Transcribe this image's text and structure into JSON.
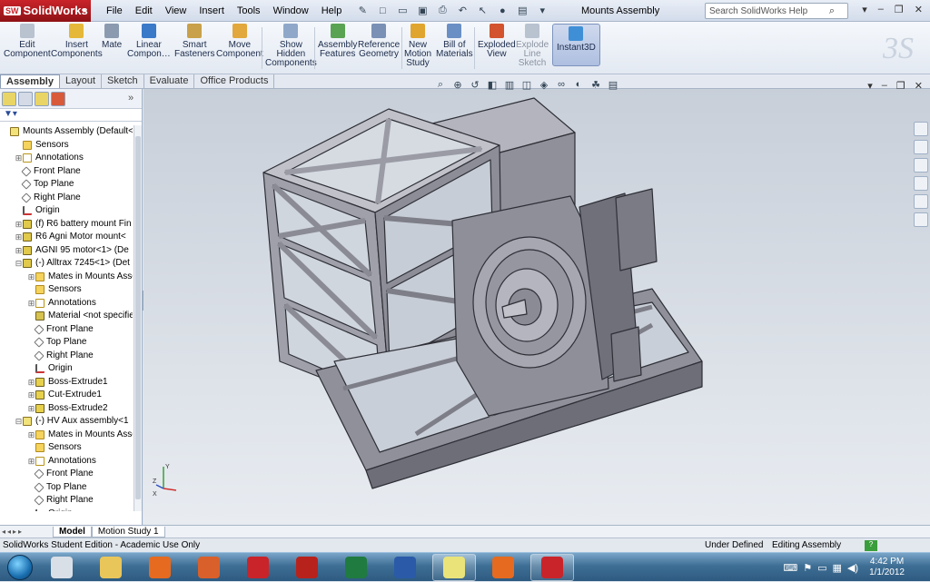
{
  "titlebar": {
    "logo_text": "SolidWorks",
    "menu": [
      "File",
      "Edit",
      "View",
      "Insert",
      "Tools",
      "Window",
      "Help"
    ],
    "document_title": "Mounts Assembly",
    "search_placeholder": "Search SolidWorks Help"
  },
  "command_manager": {
    "buttons": [
      {
        "label": "Edit\nComponent",
        "icon": "edit-component-icon",
        "enabled": false,
        "color": "#b9c2cf"
      },
      {
        "label": "Insert\nComponents",
        "icon": "insert-components-icon",
        "enabled": true,
        "color": "#e5b83a"
      },
      {
        "label": "Mate",
        "icon": "mate-icon",
        "enabled": true,
        "color": "#8c9ab0"
      },
      {
        "label": "Linear\nCompon…",
        "icon": "linear-pattern-icon",
        "enabled": true,
        "color": "#3a7ac9"
      },
      {
        "label": "Smart\nFasteners",
        "icon": "smart-fasteners-icon",
        "enabled": true,
        "color": "#c9a14a"
      },
      {
        "label": "Move\nComponent",
        "icon": "move-component-icon",
        "enabled": true,
        "color": "#e2a83c"
      },
      {
        "label": "Show\nHidden\nComponents",
        "icon": "show-hidden-components-icon",
        "enabled": true,
        "color": "#8fa8c9"
      },
      {
        "label": "Assembly\nFeatures",
        "icon": "assembly-features-icon",
        "enabled": true,
        "color": "#5aa352"
      },
      {
        "label": "Reference\nGeometry",
        "icon": "reference-geometry-icon",
        "enabled": true,
        "color": "#7a90b5"
      },
      {
        "label": "New\nMotion\nStudy",
        "icon": "new-motion-study-icon",
        "enabled": true,
        "color": "#e0a52e"
      },
      {
        "label": "Bill of\nMaterials",
        "icon": "bill-of-materials-icon",
        "enabled": true,
        "color": "#6a8fc4"
      },
      {
        "label": "Exploded\nView",
        "icon": "exploded-view-icon",
        "enabled": true,
        "color": "#d2532e"
      },
      {
        "label": "Explode\nLine\nSketch",
        "icon": "explode-line-sketch-icon",
        "enabled": false,
        "color": "#b9c2cf"
      },
      {
        "label": "Instant3D",
        "icon": "instant3d-icon",
        "enabled": true,
        "active": true,
        "color": "#3f8fd6"
      }
    ]
  },
  "tabs": [
    "Assembly",
    "Layout",
    "Sketch",
    "Evaluate",
    "Office Products"
  ],
  "feature_tree": [
    {
      "label": "Mounts Assembly  (Default<Dis",
      "icon": "assembly-icon",
      "indent": 0,
      "toggle": ""
    },
    {
      "label": "Sensors",
      "icon": "sensors-icon",
      "indent": 1,
      "toggle": ""
    },
    {
      "label": "Annotations",
      "icon": "annotations-icon",
      "indent": 1,
      "toggle": "+"
    },
    {
      "label": "Front Plane",
      "icon": "plane-icon",
      "indent": 1,
      "toggle": ""
    },
    {
      "label": "Top Plane",
      "icon": "plane-icon",
      "indent": 1,
      "toggle": ""
    },
    {
      "label": "Right Plane",
      "icon": "plane-icon",
      "indent": 1,
      "toggle": ""
    },
    {
      "label": "Origin",
      "icon": "origin-icon",
      "indent": 1,
      "toggle": ""
    },
    {
      "label": "(f) R6 battery mount Fin",
      "icon": "part-icon",
      "indent": 1,
      "toggle": "+"
    },
    {
      "label": "R6 Agni Motor mount<",
      "icon": "part-icon",
      "indent": 1,
      "toggle": "+"
    },
    {
      "label": "AGNI 95 motor<1> (De",
      "icon": "part-icon",
      "indent": 1,
      "toggle": "+"
    },
    {
      "label": "(-) Alltrax 7245<1> (Det",
      "icon": "part-icon",
      "indent": 1,
      "toggle": "-"
    },
    {
      "label": "Mates in Mounts Asser",
      "icon": "mates-folder-icon",
      "indent": 2,
      "toggle": "+"
    },
    {
      "label": "Sensors",
      "icon": "sensors-icon",
      "indent": 2,
      "toggle": ""
    },
    {
      "label": "Annotations",
      "icon": "annotations-icon",
      "indent": 2,
      "toggle": "+"
    },
    {
      "label": "Material <not specified",
      "icon": "material-icon",
      "indent": 2,
      "toggle": ""
    },
    {
      "label": "Front Plane",
      "icon": "plane-icon",
      "indent": 2,
      "toggle": ""
    },
    {
      "label": "Top Plane",
      "icon": "plane-icon",
      "indent": 2,
      "toggle": ""
    },
    {
      "label": "Right Plane",
      "icon": "plane-icon",
      "indent": 2,
      "toggle": ""
    },
    {
      "label": "Origin",
      "icon": "origin-icon",
      "indent": 2,
      "toggle": ""
    },
    {
      "label": "Boss-Extrude1",
      "icon": "boss-extrude-icon",
      "indent": 2,
      "toggle": "+"
    },
    {
      "label": "Cut-Extrude1",
      "icon": "cut-extrude-icon",
      "indent": 2,
      "toggle": "+"
    },
    {
      "label": "Boss-Extrude2",
      "icon": "boss-extrude-icon",
      "indent": 2,
      "toggle": "+"
    },
    {
      "label": "(-) HV Aux assembly<1",
      "icon": "subassembly-icon",
      "indent": 1,
      "toggle": "-"
    },
    {
      "label": "Mates in Mounts Asser",
      "icon": "mates-folder-icon",
      "indent": 2,
      "toggle": "+"
    },
    {
      "label": "Sensors",
      "icon": "sensors-icon",
      "indent": 2,
      "toggle": ""
    },
    {
      "label": "Annotations",
      "icon": "annotations-icon",
      "indent": 2,
      "toggle": "+"
    },
    {
      "label": "Front Plane",
      "icon": "plane-icon",
      "indent": 2,
      "toggle": ""
    },
    {
      "label": "Top Plane",
      "icon": "plane-icon",
      "indent": 2,
      "toggle": ""
    },
    {
      "label": "Right Plane",
      "icon": "plane-icon",
      "indent": 2,
      "toggle": ""
    },
    {
      "label": "Origin",
      "icon": "origin-icon",
      "indent": 2,
      "toggle": ""
    }
  ],
  "bottom_tabs": [
    "Model",
    "Motion Study 1"
  ],
  "status": {
    "left": "SolidWorks Student Edition - Academic Use Only",
    "state": "Under Defined",
    "mode": "Editing Assembly"
  },
  "taskbar": {
    "apps": [
      {
        "name": "file-manager-app-icon",
        "color": "#d9dfe7"
      },
      {
        "name": "explorer-folder-icon",
        "color": "#e9c65a"
      },
      {
        "name": "firefox-icon",
        "color": "#e66a1f"
      },
      {
        "name": "matlab-icon",
        "color": "#d9602a"
      },
      {
        "name": "solidworks-icon",
        "color": "#c9242a"
      },
      {
        "name": "acrobat-icon",
        "color": "#b8221c"
      },
      {
        "name": "excel-icon",
        "color": "#1f7b3f"
      },
      {
        "name": "word-icon",
        "color": "#2a5aa8"
      },
      {
        "name": "sticky-notes-icon",
        "color": "#e9e37a"
      },
      {
        "name": "firefox-icon",
        "color": "#e66a1f"
      },
      {
        "name": "solidworks-icon",
        "color": "#c9242a"
      }
    ],
    "time": "4:42 PM",
    "date": "1/1/2012"
  },
  "viewport": {
    "triad_labels": [
      "Z",
      "Y",
      "X"
    ]
  }
}
